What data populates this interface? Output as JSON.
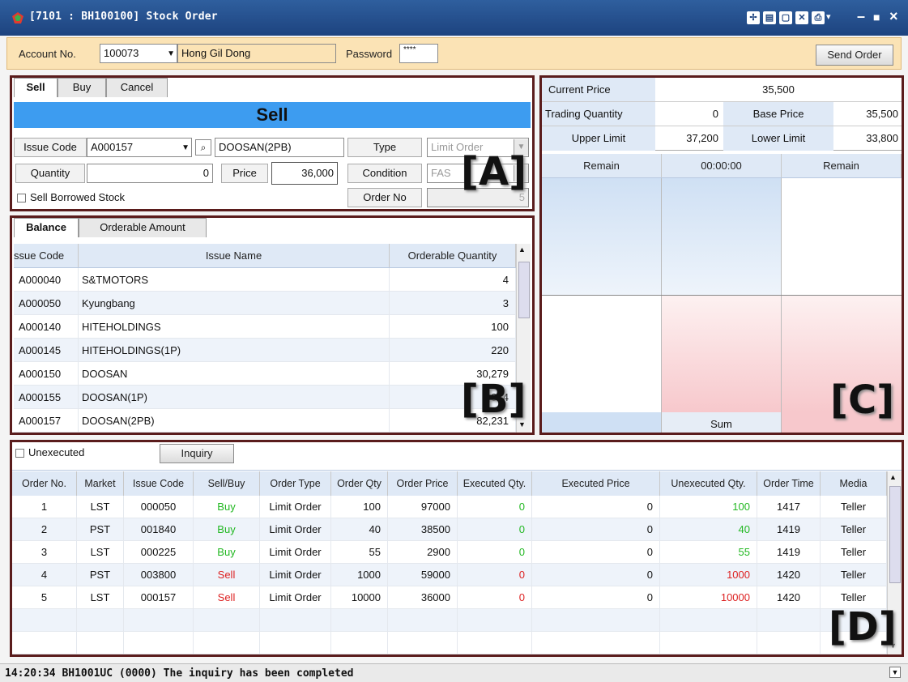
{
  "window": {
    "title": "[7101 : BH100100] Stock Order"
  },
  "account": {
    "label": "Account No.",
    "number": "100073",
    "name": "Hong Gil Dong",
    "password_label": "Password",
    "password_value": "****",
    "send_label": "Send Order"
  },
  "order_panel": {
    "tabs": [
      "Sell",
      "Buy",
      "Cancel"
    ],
    "header": "Sell",
    "issue_code_label": "Issue Code",
    "issue_code": "A000157",
    "issue_name": "DOOSAN(2PB)",
    "type_label": "Type",
    "type_value": "Limit Order",
    "quantity_label": "Quantity",
    "quantity_value": "0",
    "price_label": "Price",
    "price_value": "36,000",
    "condition_label": "Condition",
    "condition_value": "FAS",
    "borrowed_label": "Sell Borrowed Stock",
    "order_no_label": "Order No",
    "order_no_value": "5",
    "marker": "[A]"
  },
  "balance_panel": {
    "tabs": [
      "Balance",
      "Orderable Amount"
    ],
    "headers": [
      "ssue Code",
      "Issue Name",
      "Orderable Quantity"
    ],
    "rows": [
      [
        "A000040",
        "S&TMOTORS",
        "4"
      ],
      [
        "A000050",
        "Kyungbang",
        "3"
      ],
      [
        "A000140",
        "HITEHOLDINGS",
        "100"
      ],
      [
        "A000145",
        "HITEHOLDINGS(1P)",
        "220"
      ],
      [
        "A000150",
        "DOOSAN",
        "30,279"
      ],
      [
        "A000155",
        "DOOSAN(1P)",
        "9,834"
      ],
      [
        "A000157",
        "DOOSAN(2PB)",
        "82,231"
      ]
    ],
    "marker": "[B]"
  },
  "quote_panel": {
    "current_price_label": "Current Price",
    "current_price": "35,500",
    "trading_qty_label": "Trading Quantity",
    "trading_qty": "0",
    "base_price_label": "Base Price",
    "base_price": "35,500",
    "upper_limit_label": "Upper Limit",
    "upper_limit": "37,200",
    "lower_limit_label": "Lower Limit",
    "lower_limit": "33,800",
    "book_headers": [
      "Remain",
      "00:00:00",
      "Remain"
    ],
    "sum_label": "Sum",
    "marker": "[C]"
  },
  "orders_panel": {
    "unexecuted_label": "Unexecuted",
    "inquiry_label": "Inquiry",
    "headers": [
      "Order No.",
      "Market",
      "Issue Code",
      "Sell/Buy",
      "Order Type",
      "Order Qty",
      "Order Price",
      "Executed Qty.",
      "Executed Price",
      "Unexecuted Qty.",
      "Order Time",
      "Media"
    ],
    "rows": [
      [
        "1",
        "LST",
        "000050",
        "Buy",
        "Limit Order",
        "100",
        "97000",
        "0",
        "0",
        "100",
        "1417",
        "Teller"
      ],
      [
        "2",
        "PST",
        "001840",
        "Buy",
        "Limit Order",
        "40",
        "38500",
        "0",
        "0",
        "40",
        "1419",
        "Teller"
      ],
      [
        "3",
        "LST",
        "000225",
        "Buy",
        "Limit Order",
        "55",
        "2900",
        "0",
        "0",
        "55",
        "1419",
        "Teller"
      ],
      [
        "4",
        "PST",
        "003800",
        "Sell",
        "Limit Order",
        "1000",
        "59000",
        "0",
        "0",
        "1000",
        "1420",
        "Teller"
      ],
      [
        "5",
        "LST",
        "000157",
        "Sell",
        "Limit Order",
        "10000",
        "36000",
        "0",
        "0",
        "10000",
        "1420",
        "Teller"
      ]
    ],
    "marker": "[D]"
  },
  "status": {
    "message": "14:20:34 BH1001UC (0000) The inquiry has been completed"
  },
  "colors": {
    "buy": "#22b822",
    "sell": "#dd2222",
    "sell_header": "#3d9cf0",
    "panel_border": "#5a1c1c"
  }
}
